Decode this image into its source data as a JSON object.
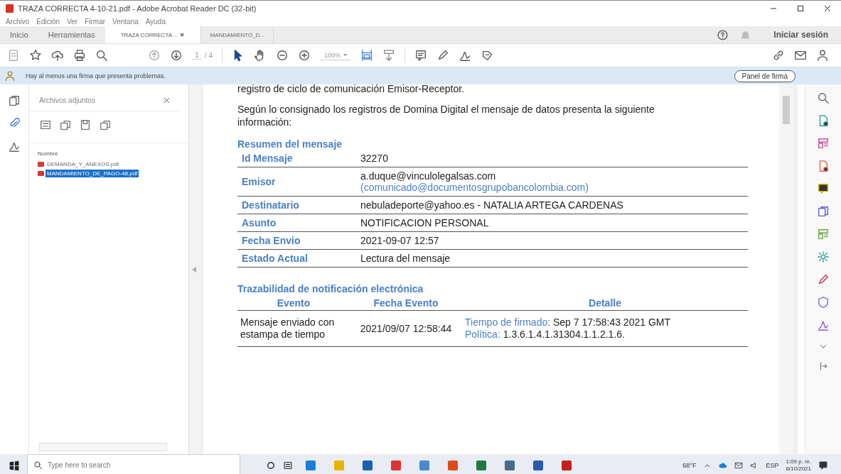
{
  "window": {
    "title": "TRAZA CORRECTA 4-10-21.pdf - Adobe Acrobat Reader DC (32-bit)"
  },
  "menu": [
    "Archivo",
    "Edición",
    "Ver",
    "Firmar",
    "Ventana",
    "Ayuda"
  ],
  "tabs": [
    {
      "label": "Inicio",
      "selected": false,
      "closable": false
    },
    {
      "label": "Herramientas",
      "selected": false,
      "closable": false
    },
    {
      "label": "TRAZA CORRECTA ...",
      "selected": true,
      "closable": true
    },
    {
      "label": "MANDAMIENTO_D...",
      "selected": false,
      "closable": false
    }
  ],
  "sign_in": "Iniciar sesión",
  "toolbar": {
    "page": "1",
    "page_total": "/ 4",
    "zoom": "100%"
  },
  "notification": {
    "text": "Hay al menos una firma que presenta problemas.",
    "button": "Panel de firma"
  },
  "attachments": {
    "title": "Archivos adjuntos",
    "column": "Nombre",
    "files": [
      {
        "name": "DEMANDA_Y_ANEXOS.pdf",
        "selected": false
      },
      {
        "name": "MANDAMIENTO_DE_PAGO-48.pdf",
        "selected": true
      }
    ]
  },
  "document": {
    "cut_line": "registro de ciclo de comunicación Emisor-Receptor.",
    "paragraph": "Según lo consignado los registros de Domina Digital el mensaje de datos presenta la siguiente información:",
    "summary_title": "Resumen del mensaje",
    "summary": [
      {
        "label": "Id Mensaje",
        "value": "32270"
      },
      {
        "label": "Emisor",
        "value": "a.duque@vinculolegalsas.com",
        "value_note": "(comunicado@documentosgrupobancolombia.com)"
      },
      {
        "label": "Destinatario",
        "value": "nebuladeporte@yahoo.es - NATALIA ARTEGA CARDENAS"
      },
      {
        "label": "Asunto",
        "value": "NOTIFICACION PERSONAL"
      },
      {
        "label": "Fecha Envio",
        "value": "2021-09-07 12:57"
      },
      {
        "label": "Estado Actual",
        "value": "Lectura del mensaje"
      }
    ],
    "trace_title": "Trazabilidad de notificación electrónica",
    "trace_columns": [
      "Evento",
      "Fecha Evento",
      "Detalle"
    ],
    "trace_rows": [
      {
        "event": "Mensaje enviado con estampa de tiempo",
        "date": "2021/09/07 12:58:44",
        "details": [
          {
            "label": "Tiempo de firmado:",
            "value": "Sep 7 17:58:43 2021 GMT"
          },
          {
            "label": "Política:",
            "value": "1.3.6.1.4.1.31304.1.1.2.1.6."
          }
        ]
      }
    ]
  },
  "taskbar": {
    "search_placeholder": "Type here to search",
    "weather": "68°F",
    "language": "ESP",
    "time": "1:09 p. m.",
    "date": "6/10/2021"
  }
}
